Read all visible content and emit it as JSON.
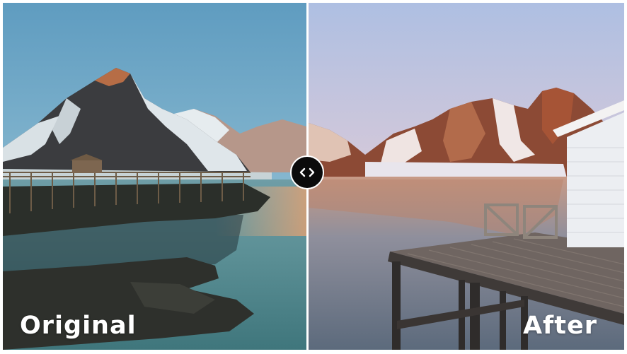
{
  "labels": {
    "before": "Original",
    "after": "After"
  },
  "slider": {
    "handle_icon": "chevrons-left-right-icon",
    "position_fraction": 0.49
  },
  "colors": {
    "divider": "#ffffff",
    "handle_fill": "#0b0b0b",
    "label_text": "#ffffff",
    "original_sky": "#6ea8c9",
    "after_sky": "#b8c6e6"
  },
  "images": {
    "before": "mountain-lake-pier-original",
    "after": "mountain-lake-pier-edited"
  }
}
